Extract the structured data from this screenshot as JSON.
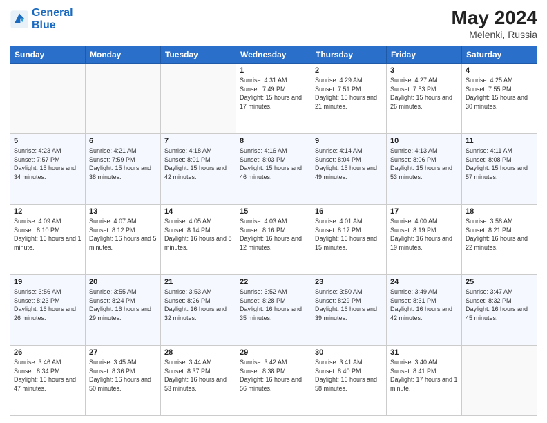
{
  "header": {
    "logo_line1": "General",
    "logo_line2": "Blue",
    "month_year": "May 2024",
    "location": "Melenki, Russia"
  },
  "days_of_week": [
    "Sunday",
    "Monday",
    "Tuesday",
    "Wednesday",
    "Thursday",
    "Friday",
    "Saturday"
  ],
  "weeks": [
    [
      {
        "day": "",
        "sunrise": "",
        "sunset": "",
        "daylight": "",
        "empty": true
      },
      {
        "day": "",
        "sunrise": "",
        "sunset": "",
        "daylight": "",
        "empty": true
      },
      {
        "day": "",
        "sunrise": "",
        "sunset": "",
        "daylight": "",
        "empty": true
      },
      {
        "day": "1",
        "sunrise": "Sunrise: 4:31 AM",
        "sunset": "Sunset: 7:49 PM",
        "daylight": "Daylight: 15 hours and 17 minutes.",
        "empty": false
      },
      {
        "day": "2",
        "sunrise": "Sunrise: 4:29 AM",
        "sunset": "Sunset: 7:51 PM",
        "daylight": "Daylight: 15 hours and 21 minutes.",
        "empty": false
      },
      {
        "day": "3",
        "sunrise": "Sunrise: 4:27 AM",
        "sunset": "Sunset: 7:53 PM",
        "daylight": "Daylight: 15 hours and 26 minutes.",
        "empty": false
      },
      {
        "day": "4",
        "sunrise": "Sunrise: 4:25 AM",
        "sunset": "Sunset: 7:55 PM",
        "daylight": "Daylight: 15 hours and 30 minutes.",
        "empty": false
      }
    ],
    [
      {
        "day": "5",
        "sunrise": "Sunrise: 4:23 AM",
        "sunset": "Sunset: 7:57 PM",
        "daylight": "Daylight: 15 hours and 34 minutes.",
        "empty": false
      },
      {
        "day": "6",
        "sunrise": "Sunrise: 4:21 AM",
        "sunset": "Sunset: 7:59 PM",
        "daylight": "Daylight: 15 hours and 38 minutes.",
        "empty": false
      },
      {
        "day": "7",
        "sunrise": "Sunrise: 4:18 AM",
        "sunset": "Sunset: 8:01 PM",
        "daylight": "Daylight: 15 hours and 42 minutes.",
        "empty": false
      },
      {
        "day": "8",
        "sunrise": "Sunrise: 4:16 AM",
        "sunset": "Sunset: 8:03 PM",
        "daylight": "Daylight: 15 hours and 46 minutes.",
        "empty": false
      },
      {
        "day": "9",
        "sunrise": "Sunrise: 4:14 AM",
        "sunset": "Sunset: 8:04 PM",
        "daylight": "Daylight: 15 hours and 49 minutes.",
        "empty": false
      },
      {
        "day": "10",
        "sunrise": "Sunrise: 4:13 AM",
        "sunset": "Sunset: 8:06 PM",
        "daylight": "Daylight: 15 hours and 53 minutes.",
        "empty": false
      },
      {
        "day": "11",
        "sunrise": "Sunrise: 4:11 AM",
        "sunset": "Sunset: 8:08 PM",
        "daylight": "Daylight: 15 hours and 57 minutes.",
        "empty": false
      }
    ],
    [
      {
        "day": "12",
        "sunrise": "Sunrise: 4:09 AM",
        "sunset": "Sunset: 8:10 PM",
        "daylight": "Daylight: 16 hours and 1 minute.",
        "empty": false
      },
      {
        "day": "13",
        "sunrise": "Sunrise: 4:07 AM",
        "sunset": "Sunset: 8:12 PM",
        "daylight": "Daylight: 16 hours and 5 minutes.",
        "empty": false
      },
      {
        "day": "14",
        "sunrise": "Sunrise: 4:05 AM",
        "sunset": "Sunset: 8:14 PM",
        "daylight": "Daylight: 16 hours and 8 minutes.",
        "empty": false
      },
      {
        "day": "15",
        "sunrise": "Sunrise: 4:03 AM",
        "sunset": "Sunset: 8:16 PM",
        "daylight": "Daylight: 16 hours and 12 minutes.",
        "empty": false
      },
      {
        "day": "16",
        "sunrise": "Sunrise: 4:01 AM",
        "sunset": "Sunset: 8:17 PM",
        "daylight": "Daylight: 16 hours and 15 minutes.",
        "empty": false
      },
      {
        "day": "17",
        "sunrise": "Sunrise: 4:00 AM",
        "sunset": "Sunset: 8:19 PM",
        "daylight": "Daylight: 16 hours and 19 minutes.",
        "empty": false
      },
      {
        "day": "18",
        "sunrise": "Sunrise: 3:58 AM",
        "sunset": "Sunset: 8:21 PM",
        "daylight": "Daylight: 16 hours and 22 minutes.",
        "empty": false
      }
    ],
    [
      {
        "day": "19",
        "sunrise": "Sunrise: 3:56 AM",
        "sunset": "Sunset: 8:23 PM",
        "daylight": "Daylight: 16 hours and 26 minutes.",
        "empty": false
      },
      {
        "day": "20",
        "sunrise": "Sunrise: 3:55 AM",
        "sunset": "Sunset: 8:24 PM",
        "daylight": "Daylight: 16 hours and 29 minutes.",
        "empty": false
      },
      {
        "day": "21",
        "sunrise": "Sunrise: 3:53 AM",
        "sunset": "Sunset: 8:26 PM",
        "daylight": "Daylight: 16 hours and 32 minutes.",
        "empty": false
      },
      {
        "day": "22",
        "sunrise": "Sunrise: 3:52 AM",
        "sunset": "Sunset: 8:28 PM",
        "daylight": "Daylight: 16 hours and 35 minutes.",
        "empty": false
      },
      {
        "day": "23",
        "sunrise": "Sunrise: 3:50 AM",
        "sunset": "Sunset: 8:29 PM",
        "daylight": "Daylight: 16 hours and 39 minutes.",
        "empty": false
      },
      {
        "day": "24",
        "sunrise": "Sunrise: 3:49 AM",
        "sunset": "Sunset: 8:31 PM",
        "daylight": "Daylight: 16 hours and 42 minutes.",
        "empty": false
      },
      {
        "day": "25",
        "sunrise": "Sunrise: 3:47 AM",
        "sunset": "Sunset: 8:32 PM",
        "daylight": "Daylight: 16 hours and 45 minutes.",
        "empty": false
      }
    ],
    [
      {
        "day": "26",
        "sunrise": "Sunrise: 3:46 AM",
        "sunset": "Sunset: 8:34 PM",
        "daylight": "Daylight: 16 hours and 47 minutes.",
        "empty": false
      },
      {
        "day": "27",
        "sunrise": "Sunrise: 3:45 AM",
        "sunset": "Sunset: 8:36 PM",
        "daylight": "Daylight: 16 hours and 50 minutes.",
        "empty": false
      },
      {
        "day": "28",
        "sunrise": "Sunrise: 3:44 AM",
        "sunset": "Sunset: 8:37 PM",
        "daylight": "Daylight: 16 hours and 53 minutes.",
        "empty": false
      },
      {
        "day": "29",
        "sunrise": "Sunrise: 3:42 AM",
        "sunset": "Sunset: 8:38 PM",
        "daylight": "Daylight: 16 hours and 56 minutes.",
        "empty": false
      },
      {
        "day": "30",
        "sunrise": "Sunrise: 3:41 AM",
        "sunset": "Sunset: 8:40 PM",
        "daylight": "Daylight: 16 hours and 58 minutes.",
        "empty": false
      },
      {
        "day": "31",
        "sunrise": "Sunrise: 3:40 AM",
        "sunset": "Sunset: 8:41 PM",
        "daylight": "Daylight: 17 hours and 1 minute.",
        "empty": false
      },
      {
        "day": "",
        "sunrise": "",
        "sunset": "",
        "daylight": "",
        "empty": true
      }
    ]
  ]
}
